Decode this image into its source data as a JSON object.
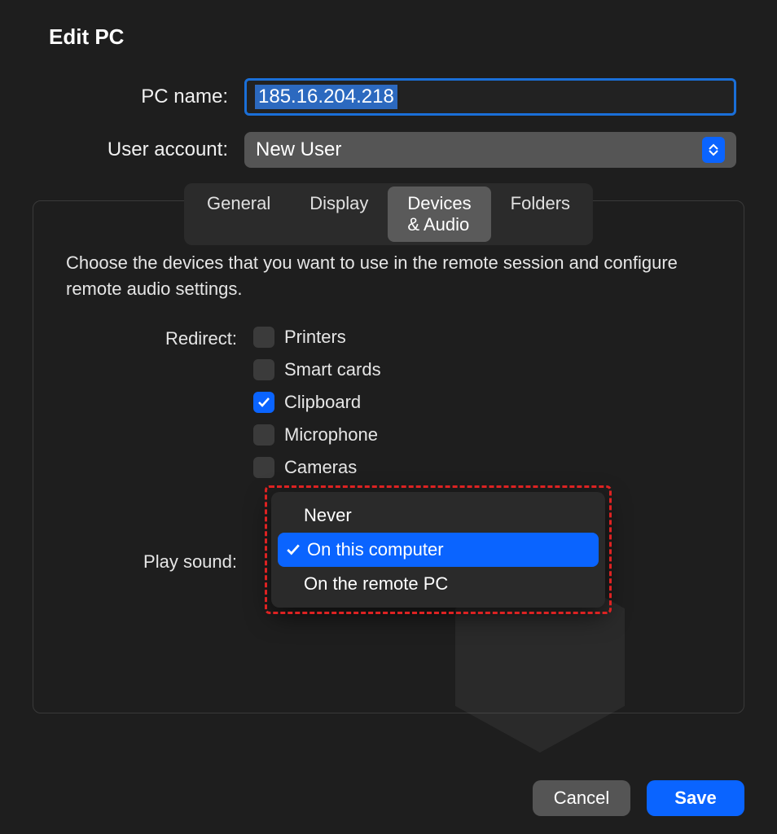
{
  "title": "Edit PC",
  "form": {
    "pc_name_label": "PC name:",
    "pc_name_value": "185.16.204.218",
    "user_account_label": "User account:",
    "user_account_value": "New User"
  },
  "tabs": {
    "general": "General",
    "display": "Display",
    "devices_audio": "Devices & Audio",
    "folders": "Folders"
  },
  "panel": {
    "helper": "Choose the devices that you want to use in the remote session and configure remote audio settings.",
    "redirect_label": "Redirect:",
    "redirect_items": {
      "printers": "Printers",
      "smart_cards": "Smart cards",
      "clipboard": "Clipboard",
      "microphone": "Microphone",
      "cameras": "Cameras"
    },
    "play_sound_label": "Play sound:",
    "play_sound_options": {
      "never": "Never",
      "on_this": "On this computer",
      "on_remote": "On the remote PC"
    }
  },
  "footer": {
    "cancel": "Cancel",
    "save": "Save"
  }
}
